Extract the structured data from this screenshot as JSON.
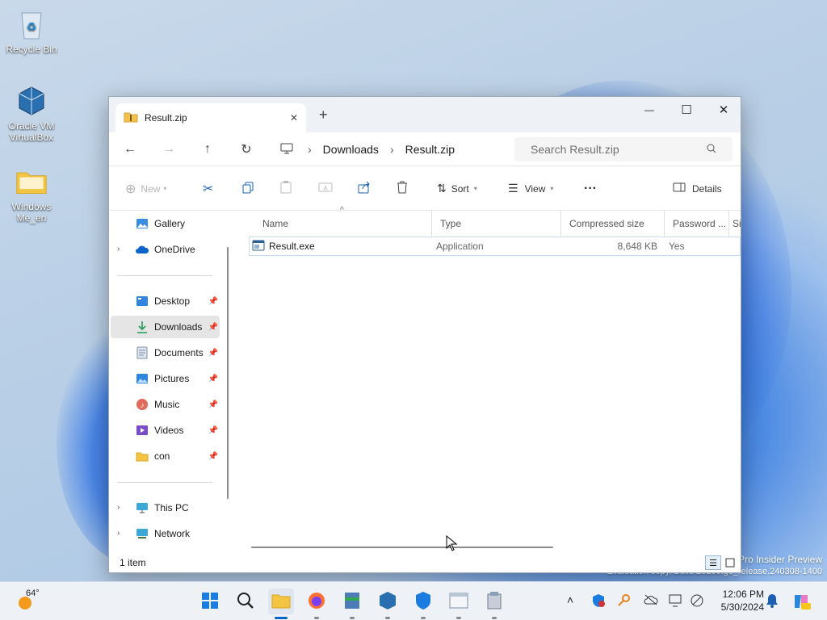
{
  "desktop": {
    "icons": [
      {
        "label": "Recycle Bin"
      },
      {
        "label": "Oracle VM VirtualBox"
      },
      {
        "label": "Windows Me_en"
      }
    ],
    "watermark_line1": "Pro Insider Preview",
    "watermark_line2": "Evaluation copy. Build 26100.ge_release.240308-1400"
  },
  "window": {
    "tab_title": "Result.zip",
    "new_tab": "+",
    "controls": {
      "minimize": "—",
      "maximize": "☐",
      "close": "✕"
    },
    "breadcrumb": [
      "Downloads",
      "Result.zip"
    ],
    "search_placeholder": "Search Result.zip",
    "toolbar": {
      "new": "New",
      "sort": "Sort",
      "view": "View",
      "more": "···",
      "details": "Details"
    },
    "sidebar": {
      "gallery": "Gallery",
      "onedrive": "OneDrive",
      "pinned": [
        "Desktop",
        "Downloads",
        "Documents",
        "Pictures",
        "Music",
        "Videos",
        "con"
      ],
      "this_pc": "This PC",
      "network": "Network"
    },
    "columns": [
      "Name",
      "Type",
      "Compressed size",
      "Password ...",
      "Si"
    ],
    "files": [
      {
        "name": "Result.exe",
        "type": "Application",
        "compressed_size": "8,648 KB",
        "password": "Yes"
      }
    ],
    "status": "1 item"
  },
  "taskbar": {
    "weather": "64°",
    "time": "12:06 PM",
    "date": "5/30/2024"
  },
  "colors": {
    "accent": "#0a64c9",
    "selected_nav": "#e5e5e5",
    "row_border": "#c8def4"
  }
}
